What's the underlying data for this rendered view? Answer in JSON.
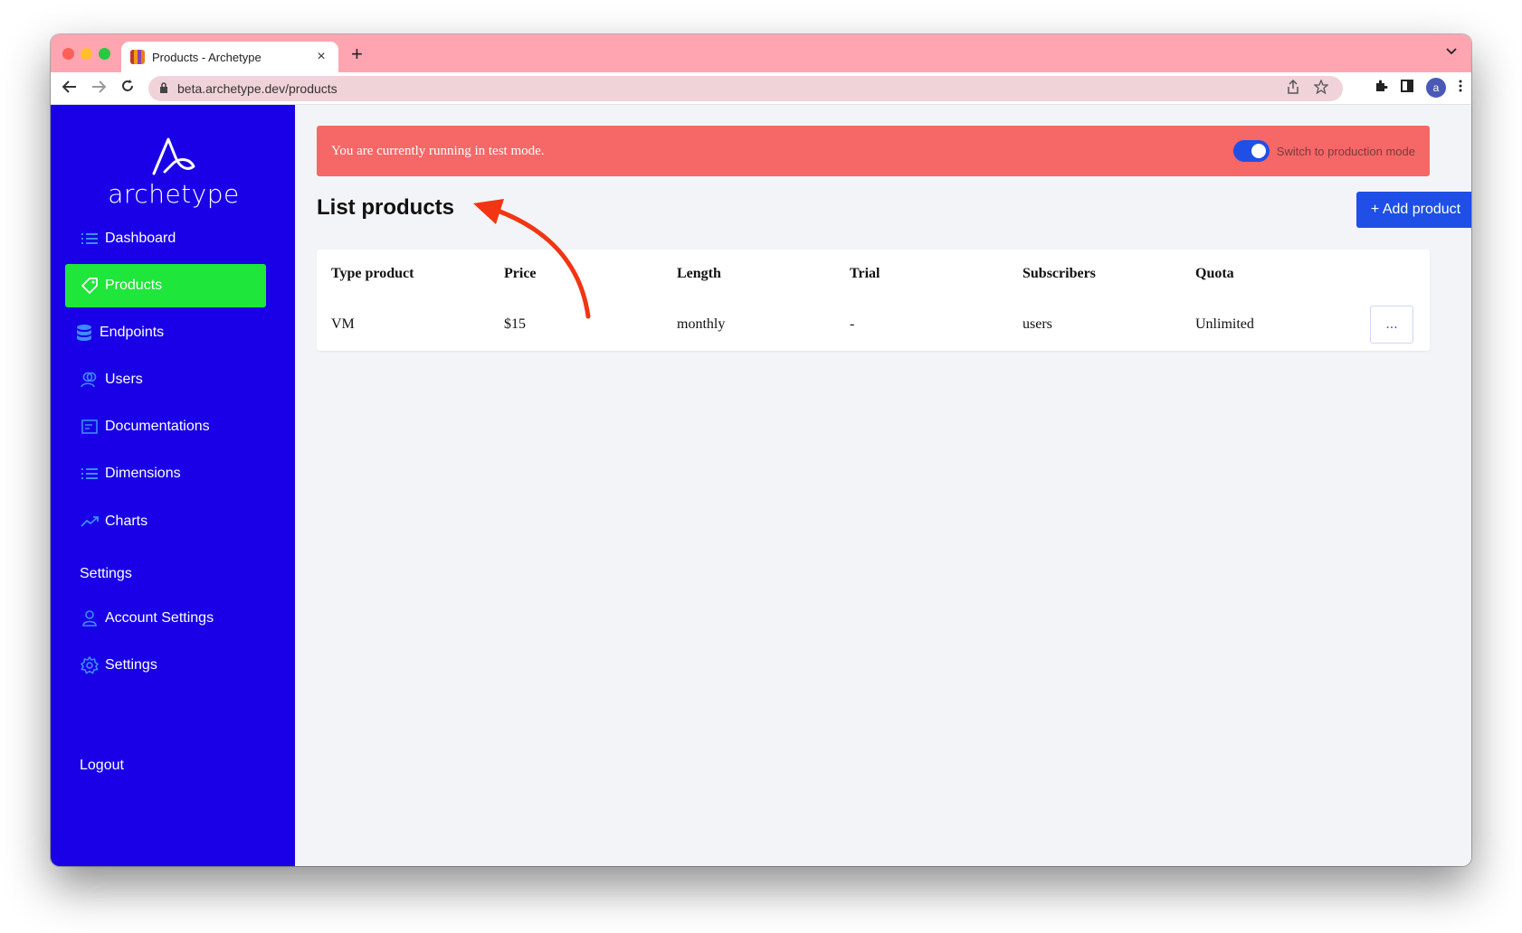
{
  "browser": {
    "tab_title": "Products - Archetype",
    "tab_close": "×",
    "new_tab": "+",
    "tab_menu": "⌄",
    "url": "beta.archetype.dev/products",
    "avatar_letter": "a"
  },
  "sidebar": {
    "logo_text": "archetype",
    "items": [
      {
        "label": "Dashboard",
        "icon": "list-icon"
      },
      {
        "label": "Products",
        "icon": "tag-icon",
        "active": true
      },
      {
        "label": "Endpoints",
        "icon": "database-icon"
      },
      {
        "label": "Users",
        "icon": "users-icon"
      },
      {
        "label": "Documentations",
        "icon": "document-icon"
      },
      {
        "label": "Dimensions",
        "icon": "list-icon"
      },
      {
        "label": "Charts",
        "icon": "trending-up-icon"
      }
    ],
    "settings_heading": "Settings",
    "settings_items": [
      {
        "label": "Account Settings",
        "icon": "user-icon"
      },
      {
        "label": "Settings",
        "icon": "gear-icon"
      }
    ],
    "logout": "Logout"
  },
  "main": {
    "banner_text": "You are currently running in test mode.",
    "toggle_label": "Switch to production mode",
    "title": "List products",
    "add_button": "+ Add product",
    "table": {
      "headers": [
        "Type product",
        "Price",
        "Length",
        "Trial",
        "Subscribers",
        "Quota"
      ],
      "rows": [
        {
          "cells": [
            "VM",
            "$15",
            "monthly",
            "-",
            "users",
            "Unlimited"
          ],
          "action": "..."
        }
      ]
    }
  },
  "colors": {
    "sidebar_bg": "#1900e6",
    "active_item": "#1fe63a",
    "banner": "#f66767",
    "primary": "#1f4fe6",
    "annotation_arrow": "#f23512"
  }
}
